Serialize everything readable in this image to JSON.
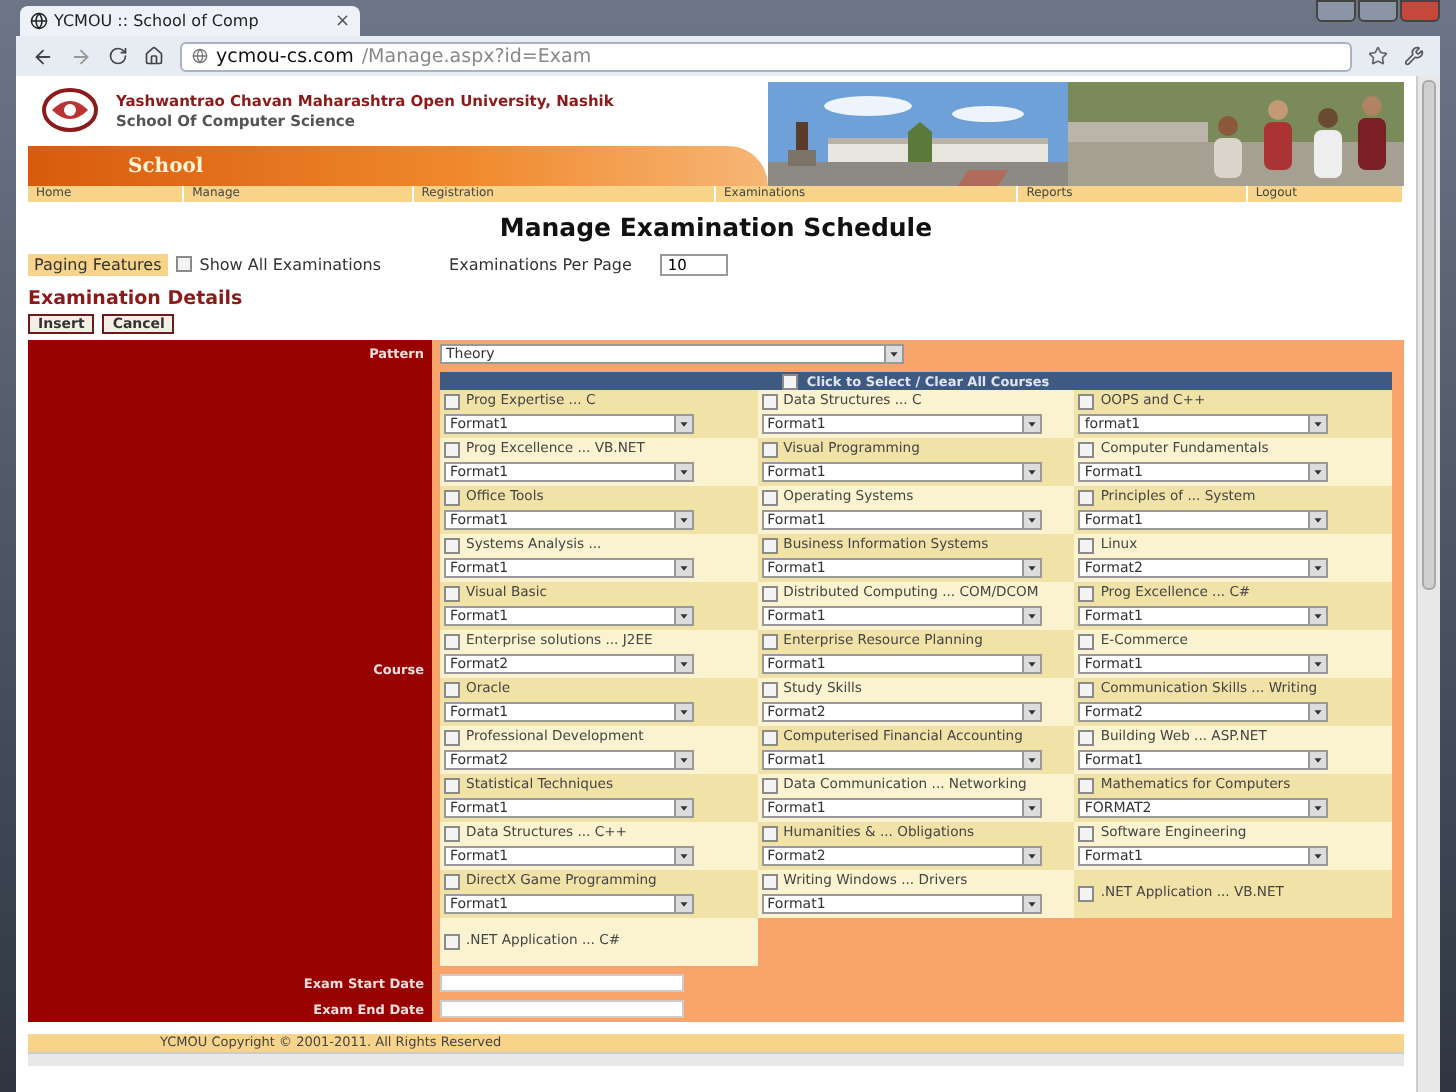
{
  "browser": {
    "tab": {
      "title": "YCMOU :: School of Comp",
      "close": "×"
    },
    "url": {
      "host": "ycmou-cs.com",
      "path": "/Manage.aspx?id=Exam"
    }
  },
  "header": {
    "university": "Yashwantrao Chavan Maharashtra Open University, Nashik",
    "school_name": "School Of Computer Science",
    "band_label": "School"
  },
  "nav": [
    {
      "label": "Home"
    },
    {
      "label": "Manage"
    },
    {
      "label": "Registration"
    },
    {
      "label": "Examinations"
    },
    {
      "label": "Reports"
    },
    {
      "label": "Logout"
    }
  ],
  "page_title": "Manage Examination Schedule",
  "paging": {
    "label": "Paging Features",
    "show_all": {
      "label": "Show All Examinations",
      "checked": false
    },
    "per_page_label": "Examinations Per Page",
    "per_page_value": "10"
  },
  "section_title": "Examination Details",
  "actions": [
    "Insert",
    "Cancel"
  ],
  "form": {
    "pattern": {
      "label": "Pattern",
      "value": "Theory"
    },
    "course": {
      "label": "Course",
      "select_all": {
        "label": "Click to Select / Clear All Courses",
        "checked": false
      },
      "items": [
        {
          "name": "Prog Expertise ... C",
          "checked": false,
          "format": "Format1"
        },
        {
          "name": "Data Structures ... C",
          "checked": false,
          "format": "Format1"
        },
        {
          "name": "OOPS and C++",
          "checked": false,
          "format": "format1"
        },
        {
          "name": "Prog Excellence ... VB.NET",
          "checked": false,
          "format": "Format1"
        },
        {
          "name": "Visual Programming",
          "checked": false,
          "format": "Format1"
        },
        {
          "name": "Computer Fundamentals",
          "checked": false,
          "format": "Format1"
        },
        {
          "name": "Office Tools",
          "checked": false,
          "format": "Format1"
        },
        {
          "name": "Operating Systems",
          "checked": false,
          "format": "Format1"
        },
        {
          "name": "Principles of ... System",
          "checked": false,
          "format": "Format1"
        },
        {
          "name": "Systems Analysis ...",
          "checked": false,
          "format": "Format1"
        },
        {
          "name": "Business Information Systems",
          "checked": false,
          "format": "Format1"
        },
        {
          "name": "Linux",
          "checked": false,
          "format": "Format2"
        },
        {
          "name": "Visual Basic",
          "checked": false,
          "format": "Format1"
        },
        {
          "name": "Distributed Computing ... COM/DCOM",
          "checked": false,
          "format": "Format1"
        },
        {
          "name": "Prog Excellence ... C#",
          "checked": false,
          "format": "Format1"
        },
        {
          "name": "Enterprise solutions ... J2EE",
          "checked": false,
          "format": "Format2"
        },
        {
          "name": "Enterprise Resource Planning",
          "checked": false,
          "format": "Format1"
        },
        {
          "name": "E-Commerce",
          "checked": false,
          "format": "Format1"
        },
        {
          "name": "Oracle",
          "checked": false,
          "format": "Format1"
        },
        {
          "name": "Study Skills",
          "checked": false,
          "format": "Format2"
        },
        {
          "name": "Communication Skills ... Writing",
          "checked": false,
          "format": "Format2"
        },
        {
          "name": "Professional Development",
          "checked": false,
          "format": "Format2"
        },
        {
          "name": "Computerised Financial Accounting",
          "checked": false,
          "format": "Format1"
        },
        {
          "name": "Building Web ... ASP.NET",
          "checked": false,
          "format": "Format1"
        },
        {
          "name": "Statistical Techniques",
          "checked": false,
          "format": "Format1"
        },
        {
          "name": "Data Communication ... Networking",
          "checked": false,
          "format": "Format1"
        },
        {
          "name": "Mathematics for Computers",
          "checked": false,
          "format": "FORMAT2"
        },
        {
          "name": "Data Structures ... C++",
          "checked": false,
          "format": "Format1"
        },
        {
          "name": "Humanities & ... Obligations",
          "checked": false,
          "format": "Format2"
        },
        {
          "name": "Software Engineering",
          "checked": false,
          "format": "Format1"
        },
        {
          "name": "DirectX Game Programming",
          "checked": false,
          "format": "Format1"
        },
        {
          "name": "Writing Windows ... Drivers",
          "checked": false,
          "format": "Format1"
        },
        {
          "name": ".NET Application ... VB.NET",
          "checked": false
        },
        {
          "name": ".NET Application ... C#",
          "checked": false
        }
      ]
    },
    "start_date": {
      "label": "Exam Start Date"
    },
    "end_date": {
      "label": "Exam End Date"
    }
  },
  "footer": "YCMOU Copyright © 2001-2011. All Rights Reserved"
}
